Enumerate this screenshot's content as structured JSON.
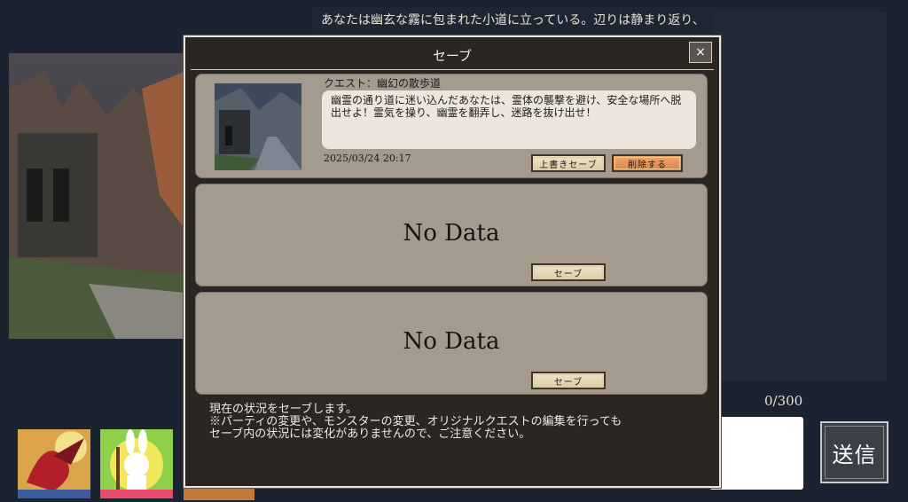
{
  "background": {
    "narrative": "あなたは幽玄な霧に包まれた小道に立っている。辺りは静まり返り、",
    "char_count": "0/300",
    "send_label": "送信"
  },
  "modal": {
    "title": "セーブ",
    "close_label": "×",
    "slots": [
      {
        "quest_title": "クエスト：幽幻の散歩道",
        "description": "幽霊の通り道に迷い込んだあなたは、霊体の襲撃を避け、安全な場所へ脱出せよ！霊気を操り、幽霊を翻弄し、迷路を抜け出せ！",
        "date": "2025/03/24 20:17",
        "overwrite_label": "上書きセーブ",
        "delete_label": "削除する"
      },
      {
        "empty_label": "No Data",
        "save_label": "セーブ"
      },
      {
        "empty_label": "No Data",
        "save_label": "セーブ"
      }
    ],
    "footer_line1": "現在の状況をセーブします。",
    "footer_line2": "※パーティの変更や、モンスターの変更、オリジナルクエストの編集を行っても",
    "footer_line3": "セーブ内の状況には変化がありませんので、ご注意ください。"
  },
  "colors": {
    "modal_bg": "#2a2622",
    "slot_bg": "#a59a8e",
    "delete_accent": "#e08c4c",
    "page_bg": "#1b2230"
  }
}
